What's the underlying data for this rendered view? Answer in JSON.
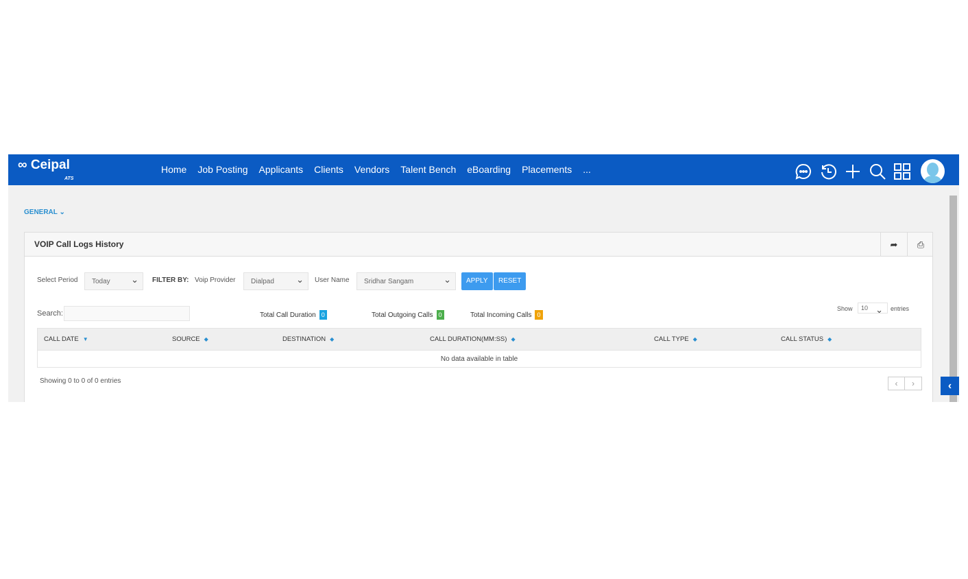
{
  "nav": {
    "brand": "Ceipal",
    "brand_sub": "ATS",
    "items": [
      "Home",
      "Job Posting",
      "Applicants",
      "Clients",
      "Vendors",
      "Talent Bench",
      "eBoarding",
      "Placements",
      "..."
    ]
  },
  "general": "GENERAL",
  "panel": {
    "title": "VOIP Call Logs History"
  },
  "filters": {
    "period_label": "Select Period",
    "period": "Today",
    "filter_by": "FILTER BY:",
    "provider_label": "Voip Provider",
    "provider": "Dialpad",
    "user_label": "User Name",
    "user": "Sridhar Sangam",
    "apply": "APPLY",
    "reset": "RESET"
  },
  "search_label": "Search:",
  "stats": [
    {
      "label": "Total Call Duration",
      "value": "0",
      "color": "#1aa3e0"
    },
    {
      "label": "Total Outgoing Calls",
      "value": "0",
      "color": "#4cae4c"
    },
    {
      "label": "Total Incoming Calls",
      "value": "0",
      "color": "#f0a30a"
    }
  ],
  "length": {
    "show": "Show",
    "value": "10",
    "entries": "entries"
  },
  "table": {
    "columns": [
      "CALL DATE",
      "SOURCE",
      "DESTINATION",
      "CALL DURATION(MM:SS)",
      "CALL TYPE",
      "CALL STATUS"
    ],
    "empty": "No data available in table"
  },
  "info": "Showing 0 to 0 of 0 entries"
}
